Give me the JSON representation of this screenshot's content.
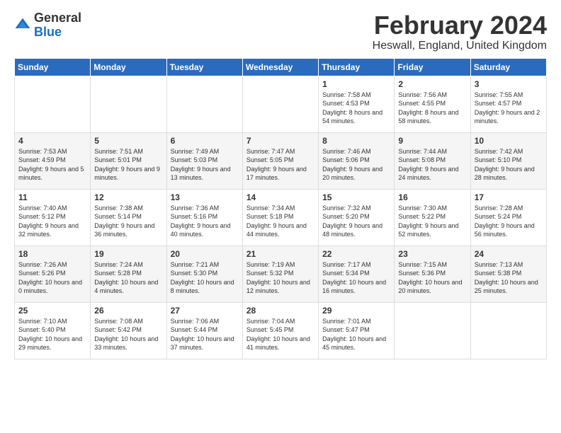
{
  "logo": {
    "general": "General",
    "blue": "Blue"
  },
  "header": {
    "title": "February 2024",
    "location": "Heswall, England, United Kingdom"
  },
  "days_of_week": [
    "Sunday",
    "Monday",
    "Tuesday",
    "Wednesday",
    "Thursday",
    "Friday",
    "Saturday"
  ],
  "weeks": [
    [
      {
        "day": "",
        "info": ""
      },
      {
        "day": "",
        "info": ""
      },
      {
        "day": "",
        "info": ""
      },
      {
        "day": "",
        "info": ""
      },
      {
        "day": "1",
        "info": "Sunrise: 7:58 AM\nSunset: 4:53 PM\nDaylight: 8 hours\nand 54 minutes."
      },
      {
        "day": "2",
        "info": "Sunrise: 7:56 AM\nSunset: 4:55 PM\nDaylight: 8 hours\nand 58 minutes."
      },
      {
        "day": "3",
        "info": "Sunrise: 7:55 AM\nSunset: 4:57 PM\nDaylight: 9 hours\nand 2 minutes."
      }
    ],
    [
      {
        "day": "4",
        "info": "Sunrise: 7:53 AM\nSunset: 4:59 PM\nDaylight: 9 hours\nand 5 minutes."
      },
      {
        "day": "5",
        "info": "Sunrise: 7:51 AM\nSunset: 5:01 PM\nDaylight: 9 hours\nand 9 minutes."
      },
      {
        "day": "6",
        "info": "Sunrise: 7:49 AM\nSunset: 5:03 PM\nDaylight: 9 hours\nand 13 minutes."
      },
      {
        "day": "7",
        "info": "Sunrise: 7:47 AM\nSunset: 5:05 PM\nDaylight: 9 hours\nand 17 minutes."
      },
      {
        "day": "8",
        "info": "Sunrise: 7:46 AM\nSunset: 5:06 PM\nDaylight: 9 hours\nand 20 minutes."
      },
      {
        "day": "9",
        "info": "Sunrise: 7:44 AM\nSunset: 5:08 PM\nDaylight: 9 hours\nand 24 minutes."
      },
      {
        "day": "10",
        "info": "Sunrise: 7:42 AM\nSunset: 5:10 PM\nDaylight: 9 hours\nand 28 minutes."
      }
    ],
    [
      {
        "day": "11",
        "info": "Sunrise: 7:40 AM\nSunset: 5:12 PM\nDaylight: 9 hours\nand 32 minutes."
      },
      {
        "day": "12",
        "info": "Sunrise: 7:38 AM\nSunset: 5:14 PM\nDaylight: 9 hours\nand 36 minutes."
      },
      {
        "day": "13",
        "info": "Sunrise: 7:36 AM\nSunset: 5:16 PM\nDaylight: 9 hours\nand 40 minutes."
      },
      {
        "day": "14",
        "info": "Sunrise: 7:34 AM\nSunset: 5:18 PM\nDaylight: 9 hours\nand 44 minutes."
      },
      {
        "day": "15",
        "info": "Sunrise: 7:32 AM\nSunset: 5:20 PM\nDaylight: 9 hours\nand 48 minutes."
      },
      {
        "day": "16",
        "info": "Sunrise: 7:30 AM\nSunset: 5:22 PM\nDaylight: 9 hours\nand 52 minutes."
      },
      {
        "day": "17",
        "info": "Sunrise: 7:28 AM\nSunset: 5:24 PM\nDaylight: 9 hours\nand 56 minutes."
      }
    ],
    [
      {
        "day": "18",
        "info": "Sunrise: 7:26 AM\nSunset: 5:26 PM\nDaylight: 10 hours\nand 0 minutes."
      },
      {
        "day": "19",
        "info": "Sunrise: 7:24 AM\nSunset: 5:28 PM\nDaylight: 10 hours\nand 4 minutes."
      },
      {
        "day": "20",
        "info": "Sunrise: 7:21 AM\nSunset: 5:30 PM\nDaylight: 10 hours\nand 8 minutes."
      },
      {
        "day": "21",
        "info": "Sunrise: 7:19 AM\nSunset: 5:32 PM\nDaylight: 10 hours\nand 12 minutes."
      },
      {
        "day": "22",
        "info": "Sunrise: 7:17 AM\nSunset: 5:34 PM\nDaylight: 10 hours\nand 16 minutes."
      },
      {
        "day": "23",
        "info": "Sunrise: 7:15 AM\nSunset: 5:36 PM\nDaylight: 10 hours\nand 20 minutes."
      },
      {
        "day": "24",
        "info": "Sunrise: 7:13 AM\nSunset: 5:38 PM\nDaylight: 10 hours\nand 25 minutes."
      }
    ],
    [
      {
        "day": "25",
        "info": "Sunrise: 7:10 AM\nSunset: 5:40 PM\nDaylight: 10 hours\nand 29 minutes."
      },
      {
        "day": "26",
        "info": "Sunrise: 7:08 AM\nSunset: 5:42 PM\nDaylight: 10 hours\nand 33 minutes."
      },
      {
        "day": "27",
        "info": "Sunrise: 7:06 AM\nSunset: 5:44 PM\nDaylight: 10 hours\nand 37 minutes."
      },
      {
        "day": "28",
        "info": "Sunrise: 7:04 AM\nSunset: 5:45 PM\nDaylight: 10 hours\nand 41 minutes."
      },
      {
        "day": "29",
        "info": "Sunrise: 7:01 AM\nSunset: 5:47 PM\nDaylight: 10 hours\nand 45 minutes."
      },
      {
        "day": "",
        "info": ""
      },
      {
        "day": "",
        "info": ""
      }
    ]
  ]
}
